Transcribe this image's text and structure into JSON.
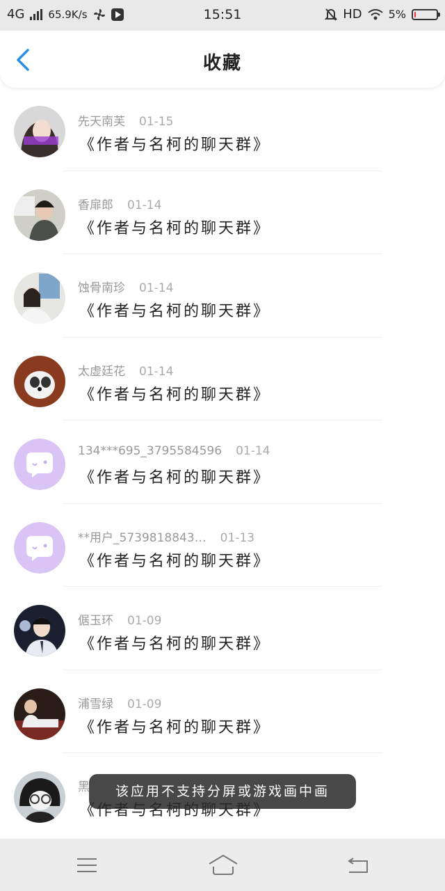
{
  "status_bar": {
    "network": "4G",
    "speed": "65.9K/s",
    "time": "15:51",
    "hd": "HD",
    "battery": "5%",
    "battery_level": 0.05
  },
  "header": {
    "title": "收藏"
  },
  "list": [
    {
      "name": "先天南芙",
      "date": "01-15",
      "message": "《作者与名柯的聊天群》",
      "avatar": "photo-avatar"
    },
    {
      "name": "香扉郎",
      "date": "01-14",
      "message": "《作者与名柯的聊天群》",
      "avatar": "photo-avatar"
    },
    {
      "name": "蚀骨南珍",
      "date": "01-14",
      "message": "《作者与名柯的聊天群》",
      "avatar": "photo-avatar"
    },
    {
      "name": "太虚廷花",
      "date": "01-14",
      "message": "《作者与名柯的聊天群》",
      "avatar": "photo-avatar"
    },
    {
      "name": "134***695_3795584596",
      "date": "01-14",
      "message": "《作者与名柯的聊天群》",
      "avatar": "default-chat-avatar"
    },
    {
      "name": "**用户_5739818843…",
      "date": "01-13",
      "message": "《作者与名柯的聊天群》",
      "avatar": "default-chat-avatar"
    },
    {
      "name": "倨玉环",
      "date": "01-09",
      "message": "《作者与名柯的聊天群》",
      "avatar": "photo-avatar"
    },
    {
      "name": "浦雪绿",
      "date": "01-09",
      "message": "《作者与名柯的聊天群》",
      "avatar": "photo-avatar"
    },
    {
      "name": "黑",
      "date": "",
      "message": "《作者与名柯的聊天群》",
      "avatar": "photo-avatar"
    }
  ],
  "toast": {
    "text": "该应用不支持分屏或游戏画中画"
  },
  "colors": {
    "accent": "#2b8ee6",
    "default_avatar_bg": "#d9c4f5"
  }
}
